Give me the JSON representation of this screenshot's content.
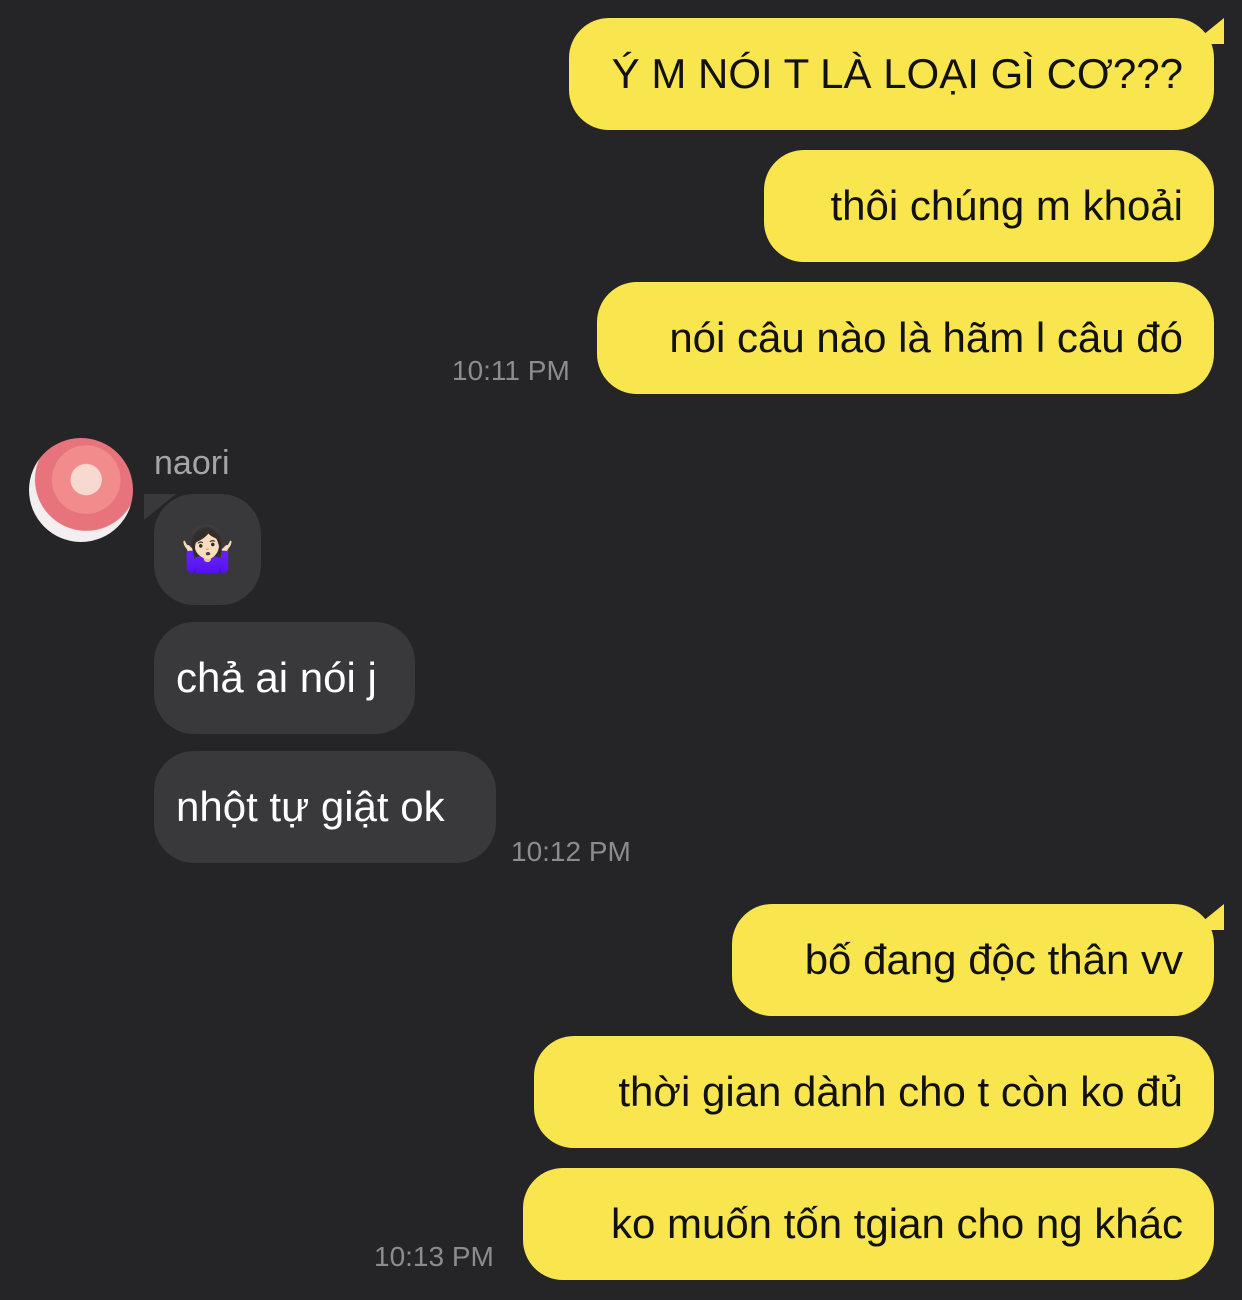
{
  "messages": [
    {
      "side": "me",
      "text": "Ý M NÓI T LÀ LOẠI GÌ CƠ???"
    },
    {
      "side": "me",
      "text": "thôi chúng m khoải"
    },
    {
      "side": "me",
      "text": "nói câu nào là hãm l câu đó"
    },
    {
      "side": "them",
      "text": "🤷🏻‍♀️"
    },
    {
      "side": "them",
      "text": "chả ai nói j"
    },
    {
      "side": "them",
      "text": "nhột tự giật ok"
    },
    {
      "side": "me",
      "text": "bố đang độc thân vv"
    },
    {
      "side": "me",
      "text": "thời gian dành cho t còn ko đủ"
    },
    {
      "side": "me",
      "text": "ko muốn tốn tgian cho ng khác"
    }
  ],
  "timestamps": [
    "10:11 PM",
    "10:12 PM",
    "10:13 PM"
  ],
  "sender": {
    "name": "naori",
    "avatar_icon": "profile-photo"
  },
  "colors": {
    "background": "#252527",
    "my_bubble": "#f9e54e",
    "their_bubble": "#39393b",
    "timestamp": "#8c8c90"
  }
}
